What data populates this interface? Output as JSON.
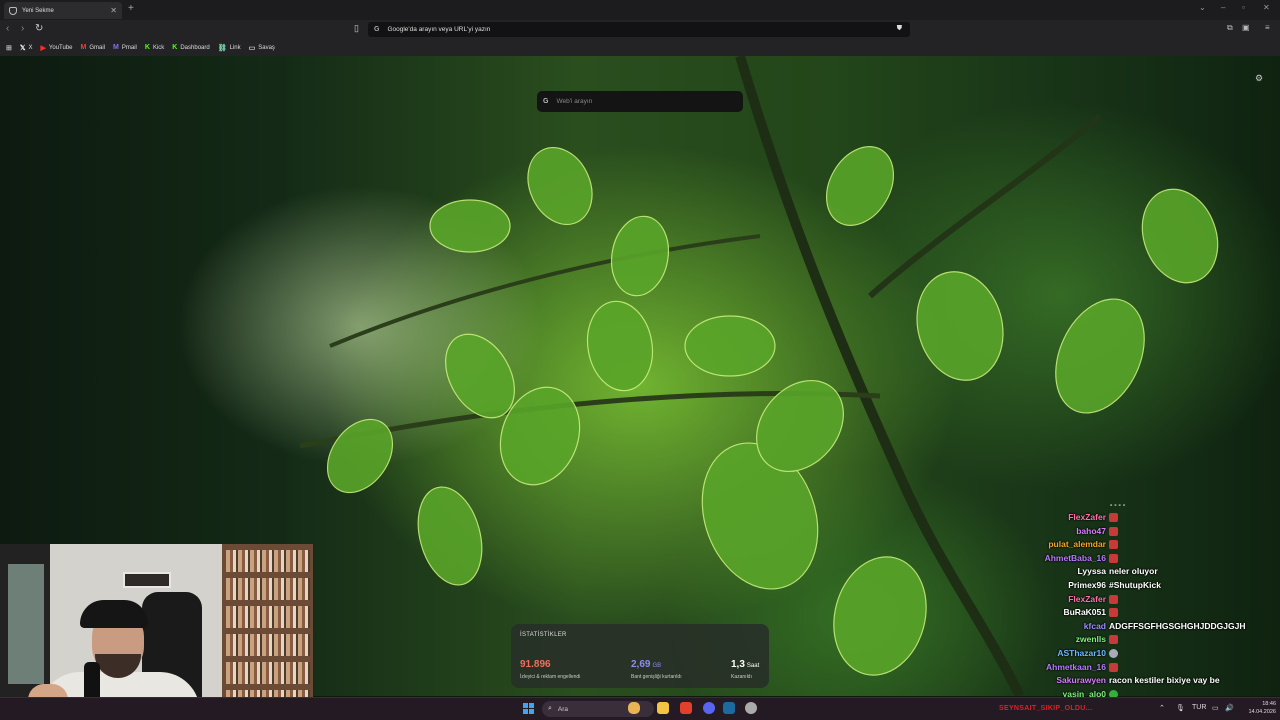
{
  "browser": {
    "tab_title": "Yeni Sekme",
    "omnibox_placeholder": "Google'da arayın veya URL'yi yazın",
    "bookmarks": [
      {
        "icon": "x-icon",
        "label": "X"
      },
      {
        "icon": "youtube-icon",
        "label": "YouTube"
      },
      {
        "icon": "gmail-icon",
        "label": "Gmail"
      },
      {
        "icon": "pmail-icon",
        "label": "Pmail"
      },
      {
        "icon": "kick-icon",
        "label": "Kick"
      },
      {
        "icon": "kick-icon",
        "label": "Dashboard"
      },
      {
        "icon": "link-icon",
        "label": "Link"
      },
      {
        "icon": "folder-icon",
        "label": "Savaş"
      }
    ]
  },
  "newtab": {
    "search_placeholder": "Web'i arayın",
    "stats_header": "İSTATİSTİKLER",
    "stats": [
      {
        "value": "91.896",
        "unit": "",
        "label": "İzleyici & reklam engellendi",
        "color": "#f26e5c"
      },
      {
        "value": "2,69",
        "unit": "GB",
        "label": "Bant genişliği kurtarıldı",
        "color": "#8f8cf5"
      },
      {
        "value": "1,3",
        "unit": "Saat",
        "label": "Kazanıldı",
        "color": "#ffffff"
      }
    ]
  },
  "chat": {
    "dots": "- - - -",
    "messages": [
      {
        "user": "FlexZafer",
        "color": "#ff6fae",
        "text": "",
        "emote": "red"
      },
      {
        "user": "baho47",
        "color": "#d77cff",
        "text": "",
        "emote": "red"
      },
      {
        "user": "pulat_alemdar",
        "color": "#f5a623",
        "text": "",
        "emote": "red"
      },
      {
        "user": "AhmetBaba_16",
        "color": "#b67bff",
        "text": "",
        "emote": "red"
      },
      {
        "user": "Lyyssa",
        "color": "#ffffff",
        "text": "neler oluyor",
        "emote": ""
      },
      {
        "user": "Primex96",
        "color": "#ffffff",
        "text": "#ShutupKick",
        "emote": ""
      },
      {
        "user": "FlexZafer",
        "color": "#ff6fae",
        "text": "",
        "emote": "red"
      },
      {
        "user": "BuRaK051",
        "color": "#ffffff",
        "text": "",
        "emote": "red"
      },
      {
        "user": "kfcad",
        "color": "#9a8cff",
        "text": "ADGFFSGFHGSGHGHJDDGJGJH",
        "emote": ""
      },
      {
        "user": "zwenlls",
        "color": "#7cf27c",
        "text": "",
        "emote": "red"
      },
      {
        "user": "ASThazar10",
        "color": "#6fb7ff",
        "text": "",
        "emote": "grey"
      },
      {
        "user": "Ahmetkaan_16",
        "color": "#b67bff",
        "text": "",
        "emote": "red"
      },
      {
        "user": "Sakurawyen",
        "color": "#d77cff",
        "text": "racon kestiler bixiye vay be",
        "emote": ""
      },
      {
        "user": "yasin_alo0",
        "color": "#7cf27c",
        "text": "",
        "emote": "green"
      }
    ]
  },
  "taskbar": {
    "search_placeholder": "Ara",
    "alert_text": "SEYNSAIT_SIKIP_OLDU...",
    "language": "TUR",
    "time": "18:46",
    "date": "14.04.2026"
  }
}
